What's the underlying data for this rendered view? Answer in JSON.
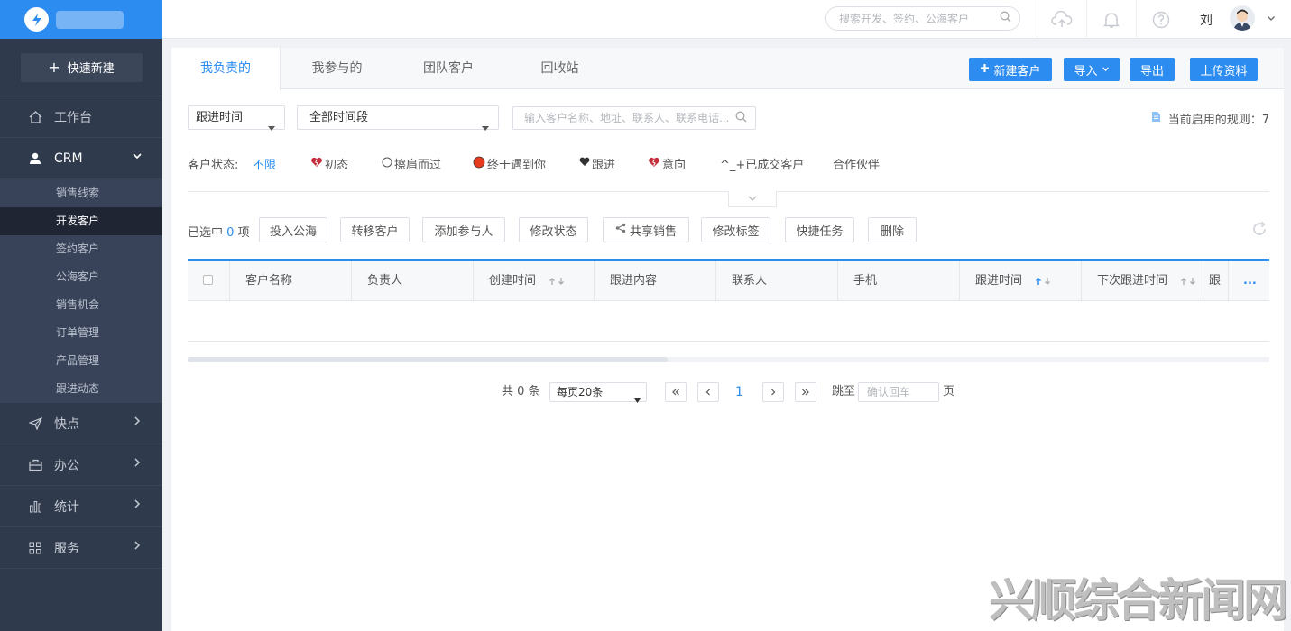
{
  "sidebar": {
    "quick_new_label": "快速新建",
    "menu": [
      {
        "label": "工作台"
      },
      {
        "label": "CRM"
      },
      {
        "label": "快点"
      },
      {
        "label": "办公"
      },
      {
        "label": "统计"
      },
      {
        "label": "服务"
      }
    ],
    "crm_sub": [
      "销售线索",
      "开发客户",
      "签约客户",
      "公海客户",
      "销售机会",
      "订单管理",
      "产品管理",
      "跟进动态"
    ],
    "active_sub": "开发客户"
  },
  "header": {
    "search_placeholder": "搜索开发、签约、公海客户",
    "user_name": "刘"
  },
  "tabs": [
    "我负责的",
    "我参与的",
    "团队客户",
    "回收站"
  ],
  "header_buttons": {
    "new_customer": "新建客户",
    "import": "导入",
    "export": "导出",
    "upload": "上传资料"
  },
  "filters": {
    "time_field": "跟进时间",
    "time_range": "全部时间段",
    "search_placeholder": "输入客户名称、地址、联系人、联系电话...",
    "rules_label": "当前启用的规则：7"
  },
  "status": {
    "label": "客户状态:",
    "options": [
      "不限",
      "初态",
      "擦肩而过",
      "终于遇到你",
      "跟进",
      "意向",
      "^_+已成交客户",
      "合作伙伴"
    ]
  },
  "actions": {
    "selected_prefix": "已选中",
    "selected_count": "0",
    "selected_suffix": "项",
    "buttons": [
      "投入公海",
      "转移客户",
      "添加参与人",
      "修改状态",
      "共享销售",
      "修改标签",
      "快捷任务",
      "删除"
    ]
  },
  "table": {
    "columns": [
      "客户名称",
      "负责人",
      "创建时间",
      "跟进内容",
      "联系人",
      "手机",
      "跟进时间",
      "下次跟进时间",
      "跟"
    ],
    "more": "..."
  },
  "pagination": {
    "total": "共 0 条",
    "page_size": "每页20条",
    "current_page": "1",
    "jump_label": "跳至",
    "jump_placeholder": "确认回车",
    "page_unit": "页"
  },
  "watermark": "兴顺综合新闻网",
  "colors": {
    "primary": "#2d8cf0",
    "sidebar": "#2f3a4d"
  }
}
